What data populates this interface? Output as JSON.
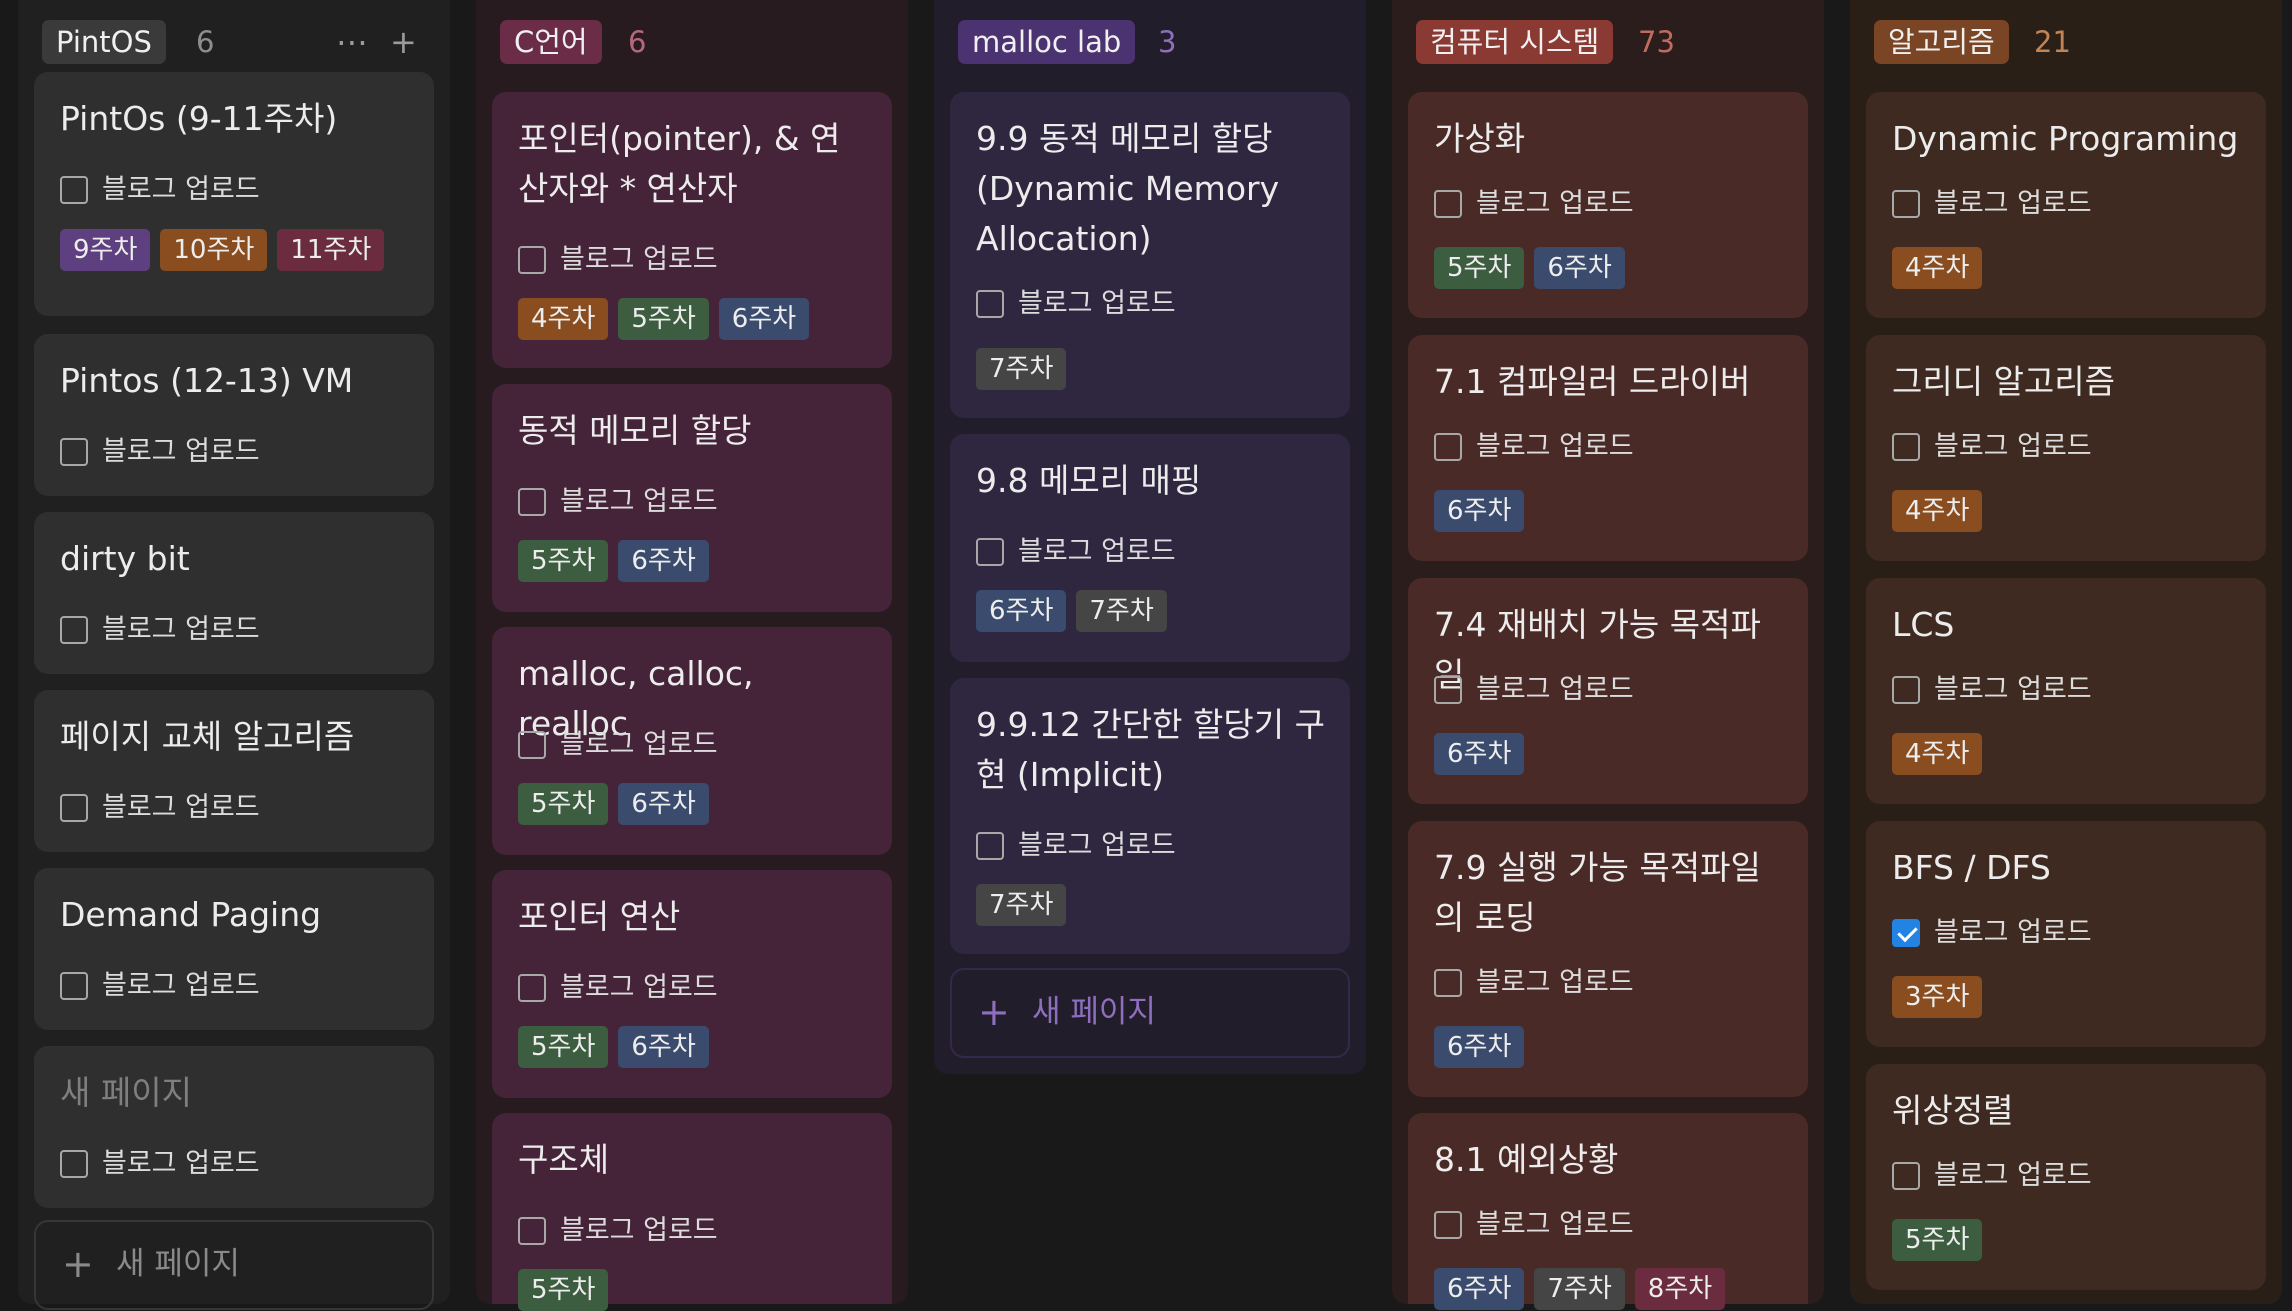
{
  "common": {
    "checkbox_label": "블로그 업로드",
    "new_page_label": "새 페이지",
    "more_icon": "⋯",
    "add_icon": "+"
  },
  "columns": [
    {
      "title": "PintOS",
      "count": "6",
      "cards": [
        {
          "title": "PintOs (9-11주차)",
          "checked": false,
          "tags": [
            "9주차",
            "10주차",
            "11주차"
          ]
        },
        {
          "title": "Pintos (12-13) VM",
          "checked": false,
          "tags": []
        },
        {
          "title": "dirty bit",
          "checked": false,
          "tags": []
        },
        {
          "title": "페이지 교체 알고리즘",
          "checked": false,
          "tags": []
        },
        {
          "title": "Demand Paging",
          "checked": false,
          "tags": []
        },
        {
          "title": "새 페이지",
          "checked": false,
          "tags": []
        }
      ]
    },
    {
      "title": "C언어",
      "count": "6",
      "cards": [
        {
          "title": "포인터(pointer), & 연산자와 * 연산자",
          "checked": false,
          "tags": [
            "4주차",
            "5주차",
            "6주차"
          ]
        },
        {
          "title": "동적 메모리 할당",
          "checked": false,
          "tags": [
            "5주차",
            "6주차"
          ]
        },
        {
          "title": "malloc, calloc, realloc",
          "checked": false,
          "tags": [
            "5주차",
            "6주차"
          ]
        },
        {
          "title": "포인터 연산",
          "checked": false,
          "tags": [
            "5주차",
            "6주차"
          ]
        },
        {
          "title": "구조체",
          "checked": false,
          "tags": [
            "5주차"
          ]
        }
      ]
    },
    {
      "title": "malloc lab",
      "count": "3",
      "cards": [
        {
          "title": "9.9 동적 메모리 할당 (Dynamic Memory Allocation)",
          "checked": false,
          "tags": [
            "7주차"
          ]
        },
        {
          "title": "9.8 메모리 매핑",
          "checked": false,
          "tags": [
            "6주차",
            "7주차"
          ]
        },
        {
          "title": "9.9.12 간단한 할당기 구현 (Implicit)",
          "checked": false,
          "tags": [
            "7주차"
          ]
        }
      ]
    },
    {
      "title": "컴퓨터 시스템",
      "count": "73",
      "cards": [
        {
          "title": "가상화",
          "checked": false,
          "tags": [
            "5주차",
            "6주차"
          ]
        },
        {
          "title": "7.1 컴파일러 드라이버",
          "checked": false,
          "tags": [
            "6주차"
          ]
        },
        {
          "title": "7.4 재배치 가능 목적파일",
          "checked": false,
          "tags": [
            "6주차"
          ]
        },
        {
          "title": "7.9 실행 가능 목적파일의 로딩",
          "checked": false,
          "tags": [
            "6주차"
          ]
        },
        {
          "title": "8.1 예외상황",
          "checked": false,
          "tags": [
            "6주차",
            "7주차",
            "8주차"
          ]
        }
      ]
    },
    {
      "title": "알고리즘",
      "count": "21",
      "cards": [
        {
          "title": "Dynamic Programing",
          "checked": false,
          "tags": [
            "4주차"
          ]
        },
        {
          "title": "그리디 알고리즘",
          "checked": false,
          "tags": [
            "4주차"
          ]
        },
        {
          "title": "LCS",
          "checked": false,
          "tags": [
            "4주차"
          ]
        },
        {
          "title": "BFS / DFS",
          "checked": true,
          "tags": [
            "3주차"
          ]
        },
        {
          "title": "위상정렬",
          "checked": false,
          "tags": [
            "5주차"
          ]
        }
      ]
    }
  ],
  "colors": {
    "tag": {
      "3주차": "#8a4d1f",
      "4주차": "#8a4d1f",
      "5주차": "#3c5d3f",
      "6주차": "#3a4b6e",
      "7주차": "#454545",
      "8주차": "#6b2c3f",
      "9주차": "#5e3f7f",
      "10주차": "#8a4d1f",
      "11주차": "#6b2c3f"
    }
  }
}
